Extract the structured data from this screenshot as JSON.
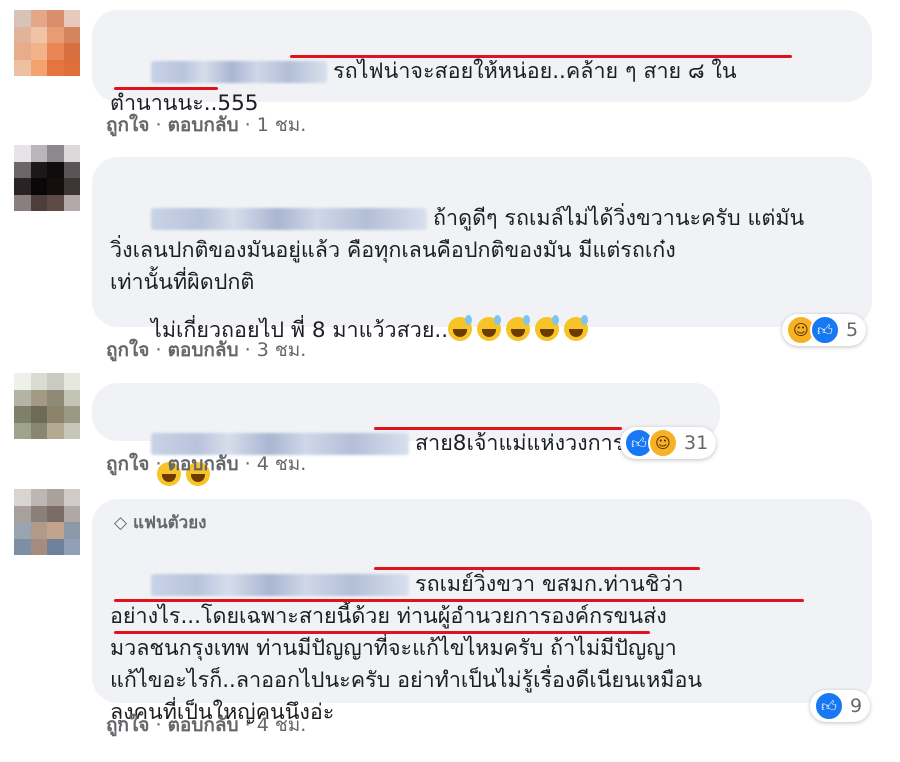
{
  "comments": [
    {
      "text": "รถไฟน่าจะสอยให้หน่อย..คล้าย ๆ สาย ๘ ใน\nตำนานนะ..555",
      "like_label": "ถูกใจ",
      "reply_label": "ตอบกลับ",
      "time": "1 ชม."
    },
    {
      "text": "ถ้าดูดีๆ รถเมล์ไม่ได้วิ่งขวานะครับ แต่มัน\nวิ่งเลนปกติของมันอยู่แล้ว คือทุกเลนคือปกติของมัน มีแต่รถเก๋ง\nเท่านั้นที่ผิดปกติ",
      "text2": "ไม่เกี่ยวถอยไป พี่ 8 มาแว้วสวย..",
      "like_label": "ถูกใจ",
      "reply_label": "ตอบกลับ",
      "time": "3 ชม.",
      "reaction_count": "5"
    },
    {
      "text": "สาย8เจ้าแม่แห่งวงการ",
      "like_label": "ถูกใจ",
      "reply_label": "ตอบกลับ",
      "time": "4 ชม.",
      "reaction_count": "31"
    },
    {
      "badge": "แฟนตัวยง",
      "text": "รถเมย์วิ่งขวา ขสมก.ท่านชิว่า\nอย่างไร...โดยเฉพาะสายนี้ด้วย ท่านผู้อำนวยการองค์กรขนส่ง\nมวลชนกรุงเทพ ท่านมีปัญญาที่จะแก้ไขไหมครับ ถ้าไม่มีปัญญา\nแก้ไขอะไรก็..ลาออกไปนะครับ อย่าทำเป็นไม่รู้เรื่องดีเนียนเหมือน\nลุงคนที่เป็นใหญ่คนนึงอ่ะ",
      "like_label": "ถูกใจ",
      "reply_label": "ตอบกลับ",
      "time": "4 ชม.",
      "reaction_count": "9"
    }
  ],
  "separator": "·",
  "colors": {
    "bubble": "#f0f2f5",
    "underline": "#e0121b",
    "meta": "#65676b",
    "like": "#1877f2"
  }
}
